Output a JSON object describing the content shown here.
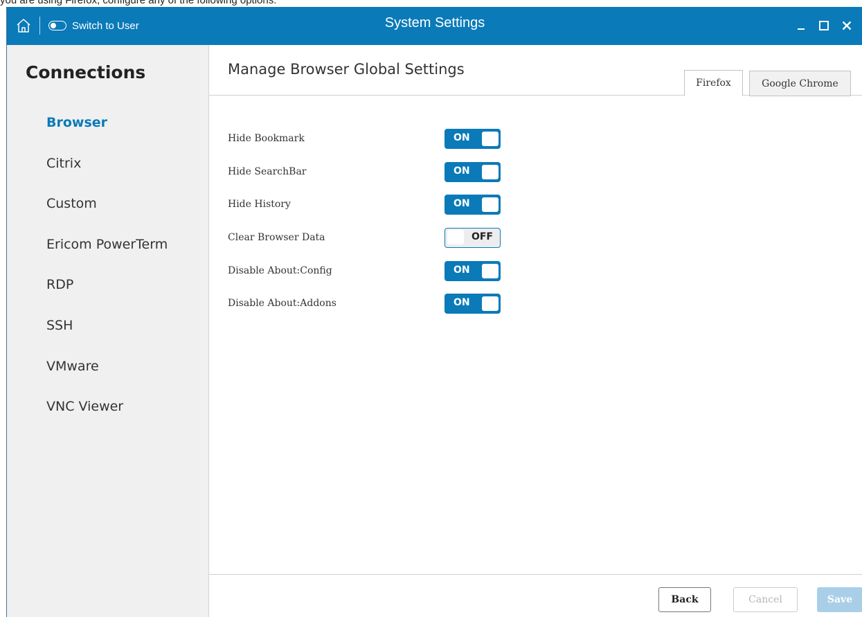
{
  "caption": "you are using Firefox, configure any of the following options:",
  "titlebar": {
    "home_icon": "home-icon",
    "switch_label": "Switch to User",
    "title": "System Settings",
    "minimize_icon": "minimize-icon",
    "maximize_icon": "maximize-icon",
    "close_icon": "close-icon"
  },
  "sidebar": {
    "title": "Connections",
    "active_item": "Browser",
    "items": [
      {
        "label": "Browser"
      },
      {
        "label": "Citrix"
      },
      {
        "label": "Custom"
      },
      {
        "label": "Ericom PowerTerm"
      },
      {
        "label": "RDP"
      },
      {
        "label": "SSH"
      },
      {
        "label": "VMware"
      },
      {
        "label": "VNC Viewer"
      }
    ]
  },
  "main": {
    "page_title": "Manage Browser Global Settings",
    "tabs": [
      {
        "label": "Firefox",
        "active": true
      },
      {
        "label": "Google Chrome",
        "active": false
      }
    ],
    "settings": [
      {
        "label": "Hide Bookmark",
        "state": "ON"
      },
      {
        "label": "Hide SearchBar",
        "state": "ON"
      },
      {
        "label": "Hide History",
        "state": "ON"
      },
      {
        "label": "Clear Browser Data",
        "state": "OFF"
      },
      {
        "label": "Disable About:Config",
        "state": "ON"
      },
      {
        "label": "Disable About:Addons",
        "state": "ON"
      }
    ]
  },
  "footer": {
    "back_label": "Back",
    "cancel_label": "Cancel",
    "save_label": "Save"
  },
  "colors": {
    "accent": "#0a7ab8",
    "sidebar_bg": "#f0f0f0",
    "save_disabled": "#a9cfe8"
  }
}
